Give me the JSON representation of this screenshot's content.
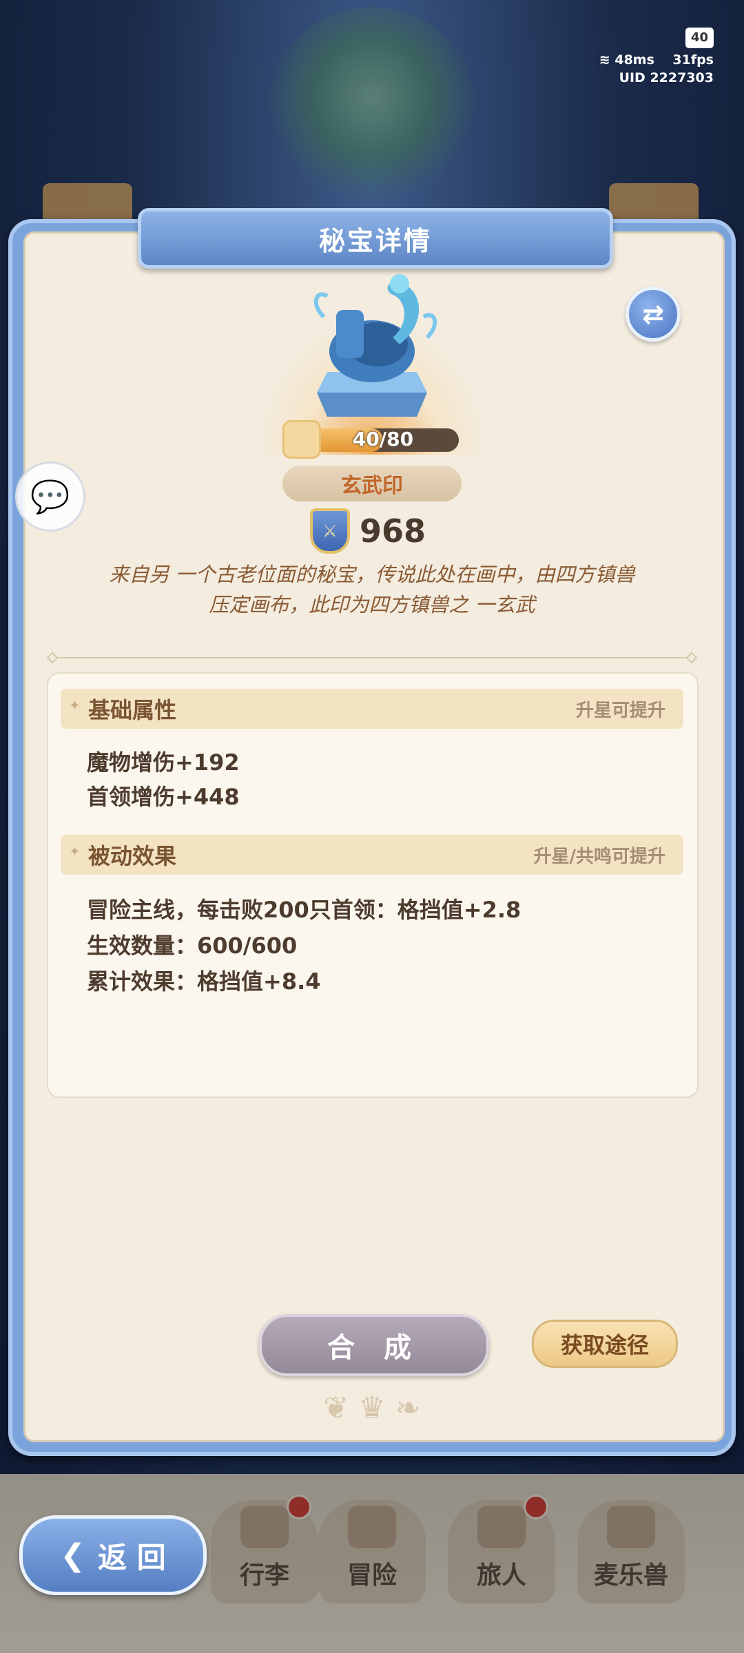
{
  "status": {
    "battery": "40",
    "ping": "48ms",
    "fps": "31fps",
    "uid": "UID 2227303"
  },
  "panel": {
    "title": "秘宝详情"
  },
  "relic": {
    "progress_text": "40/80",
    "progress": 0.5,
    "name": "玄武印",
    "power": "968",
    "description_line1": "来自另 一个古老位面的秘宝，传说此处在画中，由四方镇兽",
    "description_line2": "压定画布，此印为四方镇兽之 一玄武"
  },
  "basic_attributes": {
    "title": "基础属性",
    "hint": "升星可提升",
    "stats": [
      "魔物增伤+192",
      "首领增伤+448"
    ]
  },
  "passive_effects": {
    "title": "被动效果",
    "hint": "升星/共鸣可提升",
    "lines": [
      "冒险主线，每击败200只首领：格挡值+2.8",
      "生效数量：600/600",
      "累计效果：格挡值+8.4"
    ]
  },
  "buttons": {
    "compose": "合 成",
    "source": "获取途径",
    "back": "返 回"
  },
  "nav": [
    {
      "label": "行李"
    },
    {
      "label": "冒险"
    },
    {
      "label": "旅人"
    },
    {
      "label": "麦乐兽"
    }
  ],
  "icons": {
    "swap": "swap-icon",
    "chat": "chat-icon",
    "shield": "shield-icon",
    "puzzle": "puzzle-icon"
  },
  "colors": {
    "panel_frame": "#7ba4dc",
    "panel_bg": "#f3ecdf",
    "name_text": "#c16628",
    "description_text": "#8a5a34"
  }
}
